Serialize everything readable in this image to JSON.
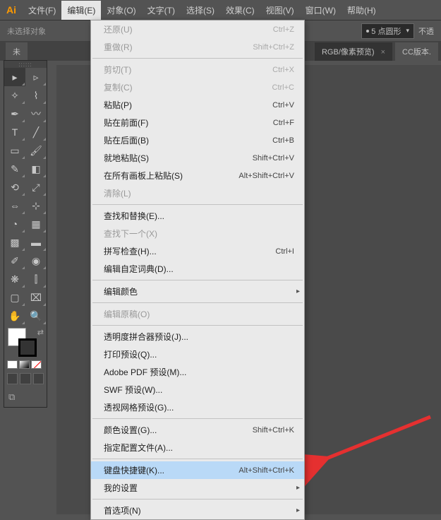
{
  "app_icon": "Ai",
  "menubar": {
    "items": [
      {
        "label": "文件(F)"
      },
      {
        "label": "编辑(E)",
        "active": true
      },
      {
        "label": "对象(O)"
      },
      {
        "label": "文字(T)"
      },
      {
        "label": "选择(S)"
      },
      {
        "label": "效果(C)"
      },
      {
        "label": "视图(V)"
      },
      {
        "label": "窗口(W)"
      },
      {
        "label": "帮助(H)"
      }
    ]
  },
  "optionsbar": {
    "no_selection": "未选择对象",
    "stroke_label": "5 点圆形",
    "opacity_label": "不透"
  },
  "tabbar": {
    "left": "未",
    "right_tab": "RGB/像素预览)",
    "cc_tab": "CC版本."
  },
  "menu": {
    "groups": [
      [
        {
          "label": "还原(U)",
          "shortcut": "Ctrl+Z",
          "disabled": true
        },
        {
          "label": "重做(R)",
          "shortcut": "Shift+Ctrl+Z",
          "disabled": true
        }
      ],
      [
        {
          "label": "剪切(T)",
          "shortcut": "Ctrl+X",
          "disabled": true
        },
        {
          "label": "复制(C)",
          "shortcut": "Ctrl+C",
          "disabled": true
        },
        {
          "label": "粘贴(P)",
          "shortcut": "Ctrl+V"
        },
        {
          "label": "贴在前面(F)",
          "shortcut": "Ctrl+F"
        },
        {
          "label": "贴在后面(B)",
          "shortcut": "Ctrl+B"
        },
        {
          "label": "就地粘贴(S)",
          "shortcut": "Shift+Ctrl+V"
        },
        {
          "label": "在所有画板上粘贴(S)",
          "shortcut": "Alt+Shift+Ctrl+V"
        },
        {
          "label": "清除(L)",
          "disabled": true
        }
      ],
      [
        {
          "label": "查找和替换(E)..."
        },
        {
          "label": "查找下一个(X)",
          "disabled": true
        },
        {
          "label": "拼写检查(H)...",
          "shortcut": "Ctrl+I"
        },
        {
          "label": "编辑自定词典(D)..."
        }
      ],
      [
        {
          "label": "编辑颜色",
          "submenu": true
        }
      ],
      [
        {
          "label": "编辑原稿(O)",
          "disabled": true
        }
      ],
      [
        {
          "label": "透明度拼合器预设(J)..."
        },
        {
          "label": "打印预设(Q)..."
        },
        {
          "label": "Adobe PDF 预设(M)..."
        },
        {
          "label": "SWF 预设(W)..."
        },
        {
          "label": "透视网格预设(G)..."
        }
      ],
      [
        {
          "label": "颜色设置(G)...",
          "shortcut": "Shift+Ctrl+K"
        },
        {
          "label": "指定配置文件(A)..."
        }
      ],
      [
        {
          "label": "键盘快捷键(K)...",
          "shortcut": "Alt+Shift+Ctrl+K",
          "highlighted": true
        },
        {
          "label": "我的设置",
          "submenu": true
        }
      ],
      [
        {
          "label": "首选项(N)",
          "submenu": true
        }
      ]
    ]
  }
}
